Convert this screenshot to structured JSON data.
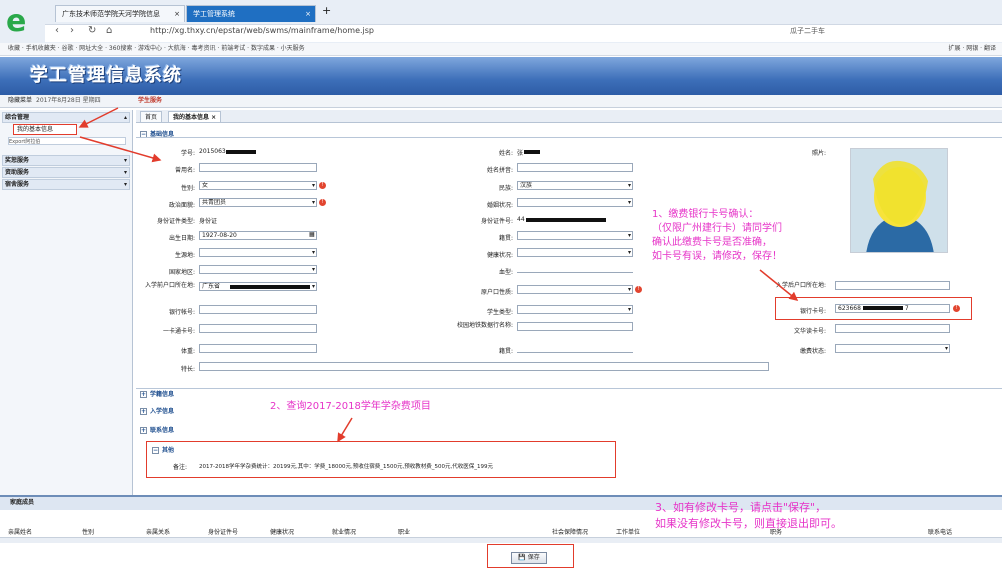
{
  "browser": {
    "tabs": [
      "广东技术师范学院天河学院信息",
      "学工管理系统"
    ],
    "url": "http://xg.thxy.cn/epstar/web/swms/mainframe/home.jsp",
    "search": "瓜子二手车",
    "bookmarks": "收藏 · 手机收藏夹 · 谷歌 · 网址大全 · 360搜索 · 游戏中心 · 大航海 · 毒考资讯 · 前端考试 · 数字成果 · 小天服务",
    "bookmarks_right": "扩展 · 网银 · 翻译"
  },
  "app": {
    "title": "学工管理信息系统",
    "hide_menu": "隐藏菜单",
    "date": "2017年8月28日 星期四",
    "module": "学生服务"
  },
  "sidebar": {
    "items": [
      "综合管理",
      "我的基本信息",
      "Export阿拉伯",
      "奖惩服务",
      "资助服务",
      "宿舍服务"
    ]
  },
  "content_tabs": [
    "首页",
    "我的基本信息"
  ],
  "sections": {
    "basic": "基础信息",
    "study": "学籍信息",
    "enroll": "入学信息",
    "contact": "联系信息",
    "other": "其他"
  },
  "form": {
    "xuehao_label": "学号:",
    "xuehao_value": "2015063",
    "xingming_label": "姓名:",
    "xingming_value": "张",
    "cengyongming_label": "曾用名:",
    "xingmingpinyin_label": "姓名拼音:",
    "xingbie_label": "性别:",
    "xingbie_value": "女",
    "minzu_label": "民族:",
    "minzu_value": "汉族",
    "zhengzhi_label": "政治面貌:",
    "zhengzhi_value": "共青团员",
    "hunyin_label": "婚姻状况:",
    "zjlx_label": "身份证件类型:",
    "zjlx_value": "身份证",
    "zjh_label": "身份证件号:",
    "zjh_value": "44",
    "csrq_label": "出生日期:",
    "csrq_value": "1927-08-20",
    "jiguan_label": "籍贯:",
    "shengyuandi_label": "生源地:",
    "jiankang_label": "健康状况:",
    "guojia_label": "国家地区:",
    "xuexing_label": "血型:",
    "hukou_label": "入学前户口所在地:",
    "hukou_value": "广东省",
    "hukouxingzhi_label": "原户口性质:",
    "yinhang_label": "银行帐号:",
    "xuesheng_label": "学生类型:",
    "yikatong_label": "一卡通卡号:",
    "xiaoyuan_label": "校园地铁数据行名称:",
    "jiguan2_label": "籍贯:",
    "tizhong_label": "体重:",
    "techang_label": "特长:",
    "photo_label": "照片:",
    "hukou_after_label": "入学后户口所在地:",
    "bank_label": "银行卡号:",
    "bank_value": "623668",
    "bank_tail": "7",
    "wenhua_label": "文华读卡号:",
    "jfzt_label": "缴费状态:",
    "remark_label": "备注:",
    "remark_value": "2017-2018学年学杂费统计：20199元,其中：学费_18000元,预收住宿费_1500元,预收教材费_500元,代收医保_199元"
  },
  "annotations": {
    "a1": "1、缴费银行卡号确认：（仅限广州建行卡）请同学们确认此缴费卡号是否准确，如卡号有误，请修改，保存！",
    "a1_lines": [
      "1、缴费银行卡号确认：",
      "（仅限广州建行卡）请同学们",
      "确认此缴费卡号是否准确，",
      "如卡号有误，请修改，保存！"
    ],
    "a2": "2、查询2017-2018学年学杂费项目",
    "a3_line1": "3、如有修改卡号，请点击\"保存\"，",
    "a3_line2": "如果没有修改卡号，则直接退出即可。"
  },
  "family": {
    "title": "家庭成员",
    "columns": [
      "亲属姓名",
      "性别",
      "亲属关系",
      "身份证件号",
      "健康状况",
      "就业情况",
      "职业",
      "社会保障情况",
      "工作单位",
      "职务",
      "联系电话"
    ]
  },
  "save_label": "保存",
  "colors": {
    "annotation": "#e633c8",
    "redbox": "#e23c2c",
    "header": "#3d6fb9"
  }
}
